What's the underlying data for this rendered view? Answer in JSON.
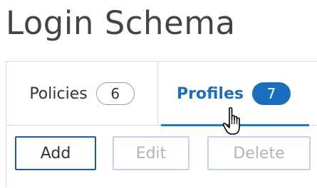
{
  "page": {
    "title": "Login Schema"
  },
  "tabs": [
    {
      "label": "Policies",
      "count": "6",
      "active": false
    },
    {
      "label": "Profiles",
      "count": "7",
      "active": true
    }
  ],
  "toolbar": {
    "add_label": "Add",
    "edit_label": "Edit",
    "delete_label": "Delete"
  },
  "colors": {
    "accent": "#1f78c8",
    "badge_active_bg": "#1a6fbd",
    "disabled_border": "#c7d3e3",
    "disabled_text": "#b3b3b3"
  },
  "cursor": {
    "icon": "hand-pointer-icon"
  }
}
